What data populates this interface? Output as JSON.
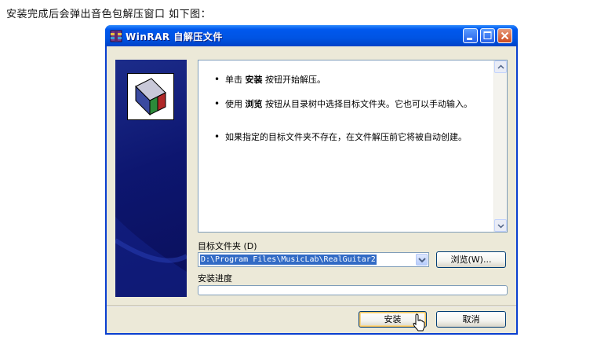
{
  "intro_text": "安装完成后会弹出音色包解压窗口  如下图：",
  "window": {
    "title": "WinRAR 自解压文件",
    "controls": {
      "minimize_icon": "minimize-icon",
      "maximize_icon": "maximize-icon",
      "close_icon": "close-icon"
    }
  },
  "info": {
    "bullets": [
      {
        "pre": "单击 ",
        "bold": "安装",
        "post": " 按钮开始解压。"
      },
      {
        "pre": "使用 ",
        "bold": "浏览",
        "post": " 按钮从目录树中选择目标文件夹。它也可以手动输入。"
      },
      {
        "pre": "",
        "bold": "",
        "post": "如果指定的目标文件夹不存在，在文件解压前它将被自动创建。"
      }
    ]
  },
  "destination": {
    "label": "目标文件夹 (D)",
    "path": "D:\\Program Files\\MusicLab\\RealGuitar2",
    "browse_label": "浏览(W)..."
  },
  "progress": {
    "label": "安装进度",
    "value": 0
  },
  "buttons": {
    "install_label": "安装",
    "cancel_label": "取消"
  },
  "colors": {
    "titlebar": "#0054e3",
    "banner": "#0d1670",
    "selection": "#316ac5"
  }
}
